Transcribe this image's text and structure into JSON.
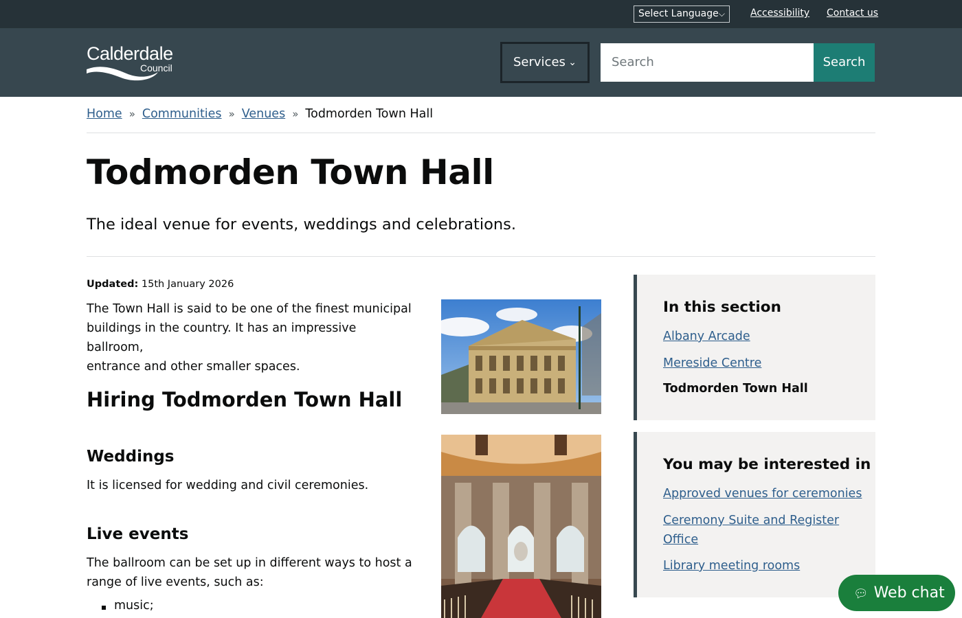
{
  "topbar": {
    "language_select": "Select Language",
    "accessibility": "Accessibility",
    "contact": "Contact us"
  },
  "header": {
    "logo_word": "Calderdale",
    "logo_sub": "Council",
    "services": "Services",
    "search_placeholder": "Search",
    "search_button": "Search"
  },
  "breadcrumb": {
    "items": [
      "Home",
      "Communities",
      "Venues"
    ],
    "separator": "»",
    "current": "Todmorden Town Hall"
  },
  "main": {
    "title": "Todmorden Town Hall",
    "lede": "The ideal venue for events, weddings and celebrations.",
    "updated_label": "Updated:",
    "updated_date": "15th January 2026",
    "intro_line1": "The Town Hall is said to be one of the finest municipal",
    "intro_line2": "buildings in the country. It has an impressive ballroom,",
    "intro_line3": "entrance and other smaller spaces.",
    "hiring_heading": "Hiring Todmorden Town Hall",
    "weddings_heading": "Weddings",
    "weddings_text": "It is licensed for wedding and civil ceremonies.",
    "live_heading": "Live events",
    "live_line1": "The ballroom can be set up in different ways to host a",
    "live_line2": "range of live events, such as:",
    "bullets": [
      "music;"
    ]
  },
  "sidebar": {
    "section_heading": "In this section",
    "section_links": [
      "Albany Arcade",
      "Mereside Centre"
    ],
    "section_current": "Todmorden Town Hall",
    "interest_heading": "You may be interested in",
    "interest_links": [
      "Approved venues for ceremonies",
      "Ceremony Suite and Register",
      "Office",
      "Library meeting rooms"
    ]
  },
  "webchat": {
    "label": "Web chat",
    "icon": "chat-bubble-icon"
  },
  "colors": {
    "topbar": "#263238",
    "header": "#37474f",
    "search_button": "#1d7d74",
    "link": "#2e5e8c",
    "webchat": "#1a7f3c"
  }
}
